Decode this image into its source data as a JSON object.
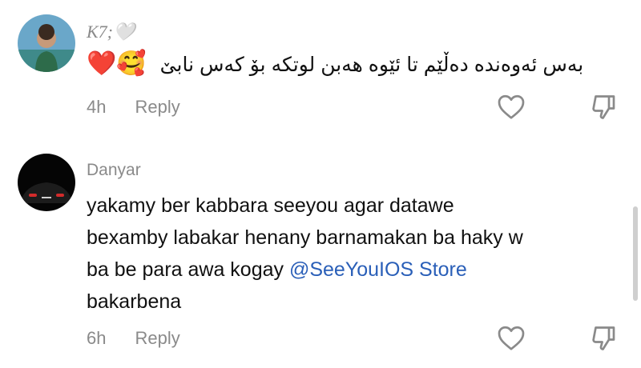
{
  "comments": [
    {
      "username": "K7;",
      "username_emoji": "🤍",
      "text_emojis": "❤️🥰",
      "text": "بەس ئەوەندە دەڵێم تا ئێوە هەبن لوتکە بۆ کەس نابێ",
      "time": "4h",
      "reply_label": "Reply"
    },
    {
      "username": "Danyar",
      "text_lines": [
        "yakamy ber kabbara seeyou agar datawe",
        "bexamby labakar henany barnamakan ba haky w",
        "ba be para awa kogay"
      ],
      "mention": "@SeeYouIOS Store",
      "text_last": "bakarbena",
      "time": "6h",
      "reply_label": "Reply"
    }
  ]
}
